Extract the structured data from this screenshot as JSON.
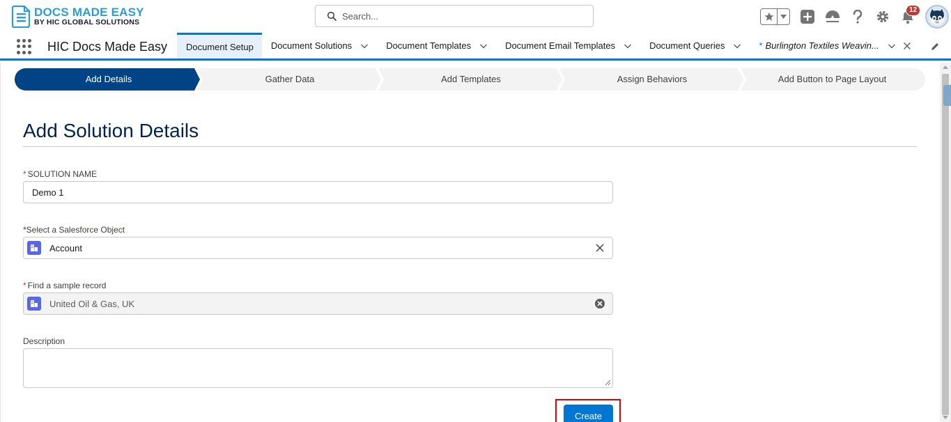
{
  "brand": {
    "logo_main": "DOCS MADE EASY",
    "logo_sub": "BY HIC GLOBAL SOLUTIONS"
  },
  "header": {
    "search_placeholder": "Search...",
    "notification_count": "12",
    "icons": [
      "star-icon",
      "chevron-down-icon",
      "plus-icon",
      "trailhead-icon",
      "help-icon",
      "gear-icon",
      "bell-icon",
      "avatar"
    ]
  },
  "nav": {
    "app_name": "HIC Docs Made Easy",
    "tabs": [
      {
        "label": "Document Setup",
        "active": true
      },
      {
        "label": "Document Solutions"
      },
      {
        "label": "Document Templates"
      },
      {
        "label": "Document Email Templates"
      },
      {
        "label": "Document Queries"
      },
      {
        "label": "Burlington Textiles Weavin...",
        "modified_marker": "*"
      }
    ]
  },
  "path": {
    "steps": [
      "Add Details",
      "Gather Data",
      "Add Templates",
      "Assign Behaviors",
      "Add Button to Page Layout"
    ],
    "active_index": 0
  },
  "form": {
    "title": "Add Solution Details",
    "solution_name_label": "SOLUTION NAME",
    "solution_name_value": "Demo 1",
    "object_label": "*Select a Salesforce Object",
    "object_value": "Account",
    "sample_record_label": "Find a sample record",
    "sample_record_value": "United Oil & Gas, UK",
    "description_label": "Description",
    "description_value": "",
    "required_marker": "*",
    "create_label": "Create"
  },
  "colors": {
    "brand_blue": "#0176d3",
    "path_active": "#014486",
    "title_navy": "#03234d",
    "object_icon": "#5867e8",
    "highlight_red": "#e00000"
  }
}
